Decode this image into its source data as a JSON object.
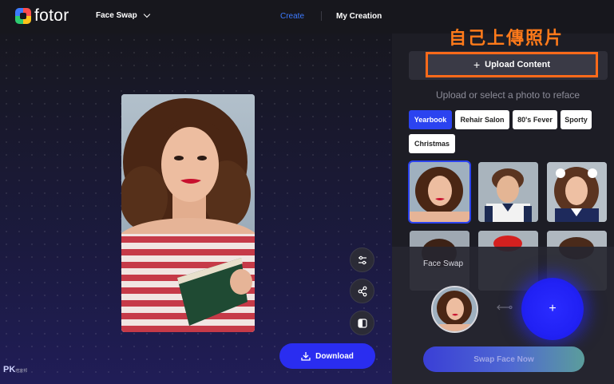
{
  "app": {
    "brand": "fotor",
    "tool_select": "Face Swap"
  },
  "nav": {
    "create": "Create",
    "my_creation": "My Creation"
  },
  "annotation": "自己上傳照片",
  "panel": {
    "upload_label": "Upload Content",
    "subtitle": "Upload or select a photo to reface",
    "categories": [
      {
        "label": "Yearbook",
        "active": true
      },
      {
        "label": "Rehair Salon",
        "active": false
      },
      {
        "label": "80's Fever",
        "active": false
      },
      {
        "label": "Sporty",
        "active": false
      },
      {
        "label": "Christmas",
        "active": false
      }
    ]
  },
  "canvas": {
    "download_label": "Download"
  },
  "swap": {
    "title": "Face Swap",
    "add_symbol": "+",
    "button_label": "Swap Face Now"
  },
  "watermark": {
    "main": "PK",
    "sub": "痞客邦"
  },
  "colors": {
    "accent": "#2b43f0",
    "highlight": "#ff6a1a",
    "create_link": "#3d7bff"
  }
}
